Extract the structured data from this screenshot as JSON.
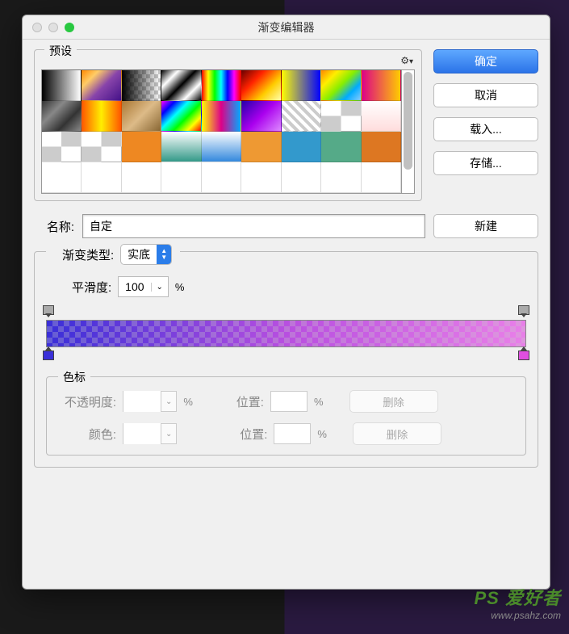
{
  "window": {
    "title": "渐变编辑器"
  },
  "presets": {
    "legend": "预设",
    "swatches": [
      {
        "bg": "linear-gradient(to right,#000,#fff)"
      },
      {
        "bg": "linear-gradient(135deg,#ff8800 0%,#ffcc66 25%,#8844aa 55%,#441188 100%)"
      },
      {
        "bg": "linear-gradient(to right,#000,transparent)",
        "chk": true
      },
      {
        "bg": "linear-gradient(135deg,#000,#fff,#000,#fff,#000)"
      },
      {
        "bg": "linear-gradient(to right,#f00,#ff0,#0f0,#0ff,#00f,#f0f,#f00)"
      },
      {
        "bg": "linear-gradient(135deg,#660000,#ff2200,#ffcc00,#ffffaa)"
      },
      {
        "bg": "linear-gradient(to right,#ff0,#00f)"
      },
      {
        "bg": "linear-gradient(135deg,#ff8800,#ffee00,#88ee00,#00aaff,#88ccff)"
      },
      {
        "bg": "linear-gradient(to right,#dd0088,#ffcc00)"
      },
      {
        "bg": "linear-gradient(135deg,#333,#888,#333,#888)"
      },
      {
        "bg": "linear-gradient(to right,#ff5500,#ffee00,#ff5500)"
      },
      {
        "bg": "linear-gradient(135deg,#aa7733,#ddbb88,#886633)"
      },
      {
        "bg": "linear-gradient(135deg,#f0f,#00f,#0ff,#0f0,#ff0,#f00)"
      },
      {
        "bg": "linear-gradient(to right,#ff0,#dd0088,#00aaff)"
      },
      {
        "bg": "linear-gradient(135deg,#2200aa,#aa00ee,#dd88ff)"
      },
      {
        "bg": "repeating-linear-gradient(45deg,#fff,#fff 4px,#ccc 4px,#ccc 8px)"
      },
      {
        "bg": "transparent",
        "chk": true
      },
      {
        "bg": "linear-gradient(to bottom,#fff,#ffdddd)"
      },
      {
        "bg": "white",
        "chk": true
      },
      {
        "bg": "transparent",
        "chk": true
      },
      {
        "bg": "#ee8822"
      },
      {
        "bg": "linear-gradient(to bottom,#fff,#339988)"
      },
      {
        "bg": "linear-gradient(to bottom,#fff,#3388dd)"
      },
      {
        "bg": "#ee9933"
      },
      {
        "bg": "#3399cc"
      },
      {
        "bg": "#55aa88"
      },
      {
        "bg": "#dd7722"
      },
      {
        "bg": "transparent"
      },
      {
        "bg": "transparent"
      },
      {
        "bg": "transparent"
      },
      {
        "bg": "transparent"
      },
      {
        "bg": "transparent"
      },
      {
        "bg": "transparent"
      },
      {
        "bg": "transparent"
      },
      {
        "bg": "transparent"
      },
      {
        "bg": "transparent"
      }
    ]
  },
  "buttons": {
    "ok": "确定",
    "cancel": "取消",
    "load": "载入...",
    "save": "存储...",
    "new": "新建"
  },
  "name": {
    "label": "名称:",
    "value": "自定"
  },
  "gradientType": {
    "label": "渐变类型:",
    "value": "实底"
  },
  "smoothness": {
    "label": "平滑度:",
    "value": "100",
    "unit": "%"
  },
  "stops": {
    "legend": "色标",
    "opacity": {
      "label": "不透明度:",
      "unit": "%"
    },
    "color": {
      "label": "颜色:"
    },
    "position": {
      "label": "位置:",
      "unit": "%"
    },
    "delete": "删除"
  },
  "gradient": {
    "leftColor": "#3a2fd8",
    "rightColor": "#e04fe0"
  },
  "watermark": {
    "line1_a": "PS",
    "line1_b": "爱好者",
    "line2": "www.psahz.com"
  }
}
